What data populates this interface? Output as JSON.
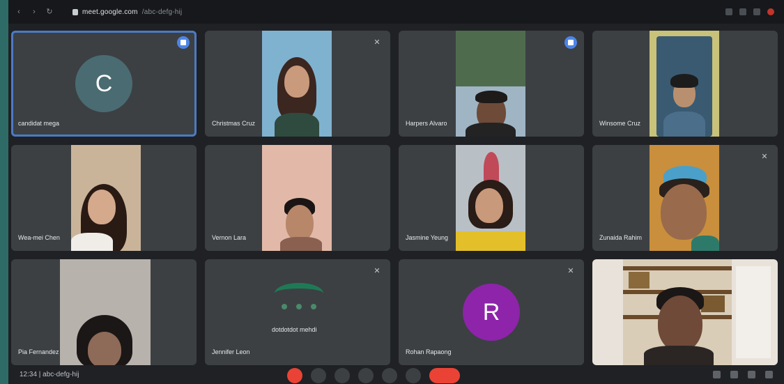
{
  "browser": {
    "url_site": "meet.google.com",
    "url_path": "/abc-defg-hij"
  },
  "participants": [
    {
      "name": "candidat mega",
      "type": "avatar",
      "initial": "C",
      "avatar_color": "#4a6b72",
      "active": true
    },
    {
      "name": "Christmas Cruz",
      "type": "video"
    },
    {
      "name": "Harpers Alvaro",
      "type": "video"
    },
    {
      "name": "Winsome Cruz",
      "type": "video"
    },
    {
      "name": "Wea-mei Chen",
      "type": "video"
    },
    {
      "name": "Vernon Lara",
      "type": "video"
    },
    {
      "name": "Jasmine Yeung",
      "type": "video"
    },
    {
      "name": "Zunaida Rahim",
      "type": "video"
    },
    {
      "name": "Pia Fernandez",
      "type": "video"
    },
    {
      "name": "Jennifer Leon",
      "type": "video"
    },
    {
      "name": "Rohan Rapaong",
      "type": "avatar",
      "initial": "R",
      "avatar_color": "#8e24aa"
    },
    {
      "name": "",
      "type": "video"
    }
  ],
  "presenting_label": "dotdotdot mehdi",
  "bottom": {
    "meeting_info": "12:34 | abc-defg-hij"
  },
  "colors": {
    "tile_bg": "#3c4043",
    "active_border": "#4c7ac4",
    "end_call": "#ea4335"
  }
}
